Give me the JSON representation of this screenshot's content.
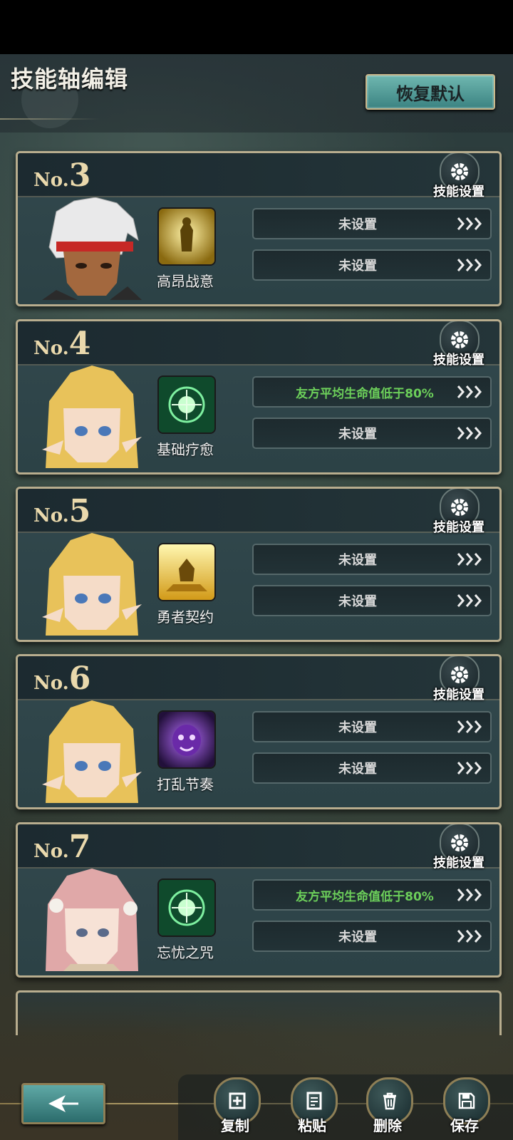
{
  "header": {
    "title": "技能轴编辑",
    "restore_label": "恢复默认"
  },
  "cards": [
    {
      "no_prefix": "No.",
      "no": "3",
      "skill_name": "高昂战意",
      "gear_label": "技能设置",
      "conditions": [
        "未设置",
        "未设置"
      ],
      "portrait": "warrior-white-hair",
      "icon": "golden-warrior-skill-icon"
    },
    {
      "no_prefix": "No.",
      "no": "4",
      "skill_name": "基础疗愈",
      "gear_label": "技能设置",
      "conditions": [
        "友方平均生命值低于80%",
        "未设置"
      ],
      "portrait": "elf-blonde",
      "icon": "green-heal-skill-icon"
    },
    {
      "no_prefix": "No.",
      "no": "5",
      "skill_name": "勇者契约",
      "gear_label": "技能设置",
      "conditions": [
        "未设置",
        "未设置"
      ],
      "portrait": "elf-blonde",
      "icon": "golden-contract-skill-icon"
    },
    {
      "no_prefix": "No.",
      "no": "6",
      "skill_name": "打乱节奏",
      "gear_label": "技能设置",
      "conditions": [
        "未设置",
        "未设置"
      ],
      "portrait": "elf-blonde",
      "icon": "purple-ghost-skill-icon"
    },
    {
      "no_prefix": "No.",
      "no": "7",
      "skill_name": "忘忧之咒",
      "gear_label": "技能设置",
      "conditions": [
        "友方平均生命值低于80%",
        "未设置"
      ],
      "portrait": "pink-hair-girl",
      "icon": "green-heal-skill-icon"
    }
  ],
  "actions": {
    "copy": "复制",
    "paste": "粘贴",
    "delete": "删除",
    "save": "保存"
  },
  "colors": {
    "accent_teal": "#4f9c9a",
    "gold_border": "#b8ad8e",
    "active_condition": "#6ccf5a"
  }
}
